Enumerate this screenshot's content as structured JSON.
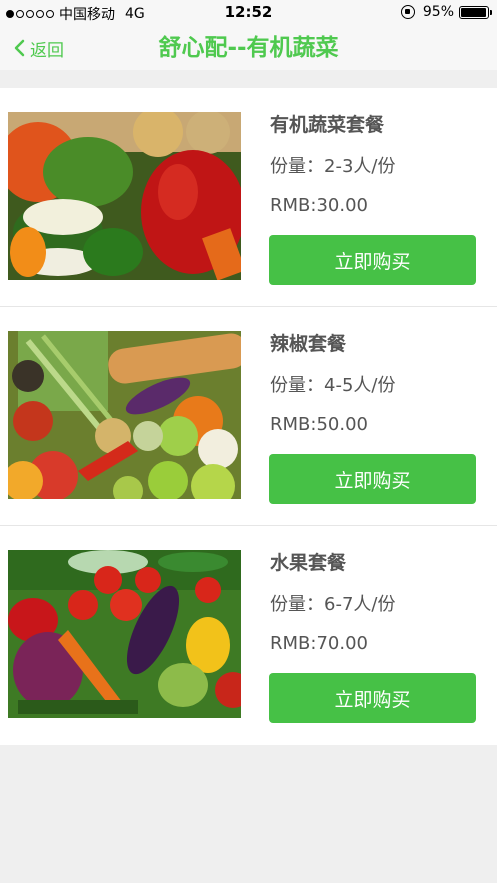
{
  "status_bar": {
    "carrier": "中国移动",
    "network": "4G",
    "time": "12:52",
    "battery": "95%"
  },
  "nav": {
    "back_label": "返回",
    "title": "舒心配--有机蔬菜"
  },
  "items": [
    {
      "name": "有机蔬菜套餐",
      "portion": "份量：2-3人/份",
      "price": "RMB:30.00",
      "buy_label": "立即购买"
    },
    {
      "name": "辣椒套餐",
      "portion": "份量：4-5人/份",
      "price": "RMB:50.00",
      "buy_label": "立即购买"
    },
    {
      "name": "水果套餐",
      "portion": "份量：6-7人/份",
      "price": "RMB:70.00",
      "buy_label": "立即购买"
    }
  ]
}
